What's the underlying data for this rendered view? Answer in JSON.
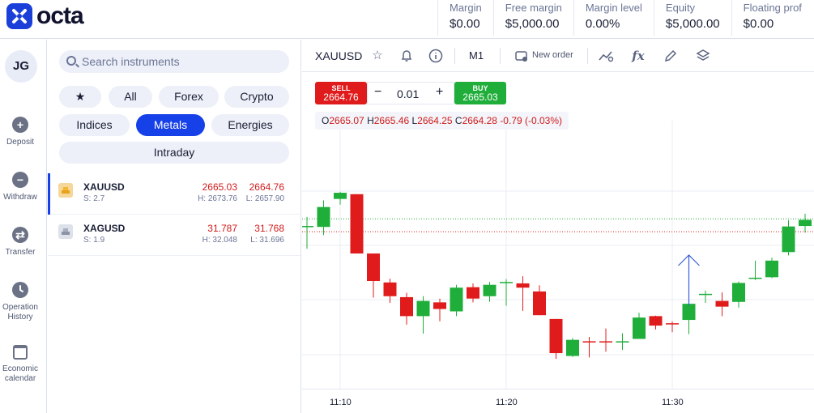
{
  "app": {
    "brand": "octa"
  },
  "account": {
    "stats": [
      {
        "label": "Margin",
        "value": "$0.00"
      },
      {
        "label": "Free margin",
        "value": "$5,000.00"
      },
      {
        "label": "Margin level",
        "value": "0.00%"
      },
      {
        "label": "Equity",
        "value": "$5,000.00"
      },
      {
        "label": "Floating prof",
        "value": "$0.00"
      }
    ]
  },
  "nav": {
    "avatar": "JG",
    "items": [
      {
        "label": "Deposit",
        "icon": "plus-circle-icon"
      },
      {
        "label": "Withdraw",
        "icon": "minus-circle-icon"
      },
      {
        "label": "Transfer",
        "icon": "transfer-icon"
      },
      {
        "label": "Operation History",
        "icon": "clock-icon"
      },
      {
        "label": "Economic calendar",
        "icon": "calendar-icon"
      }
    ]
  },
  "instruments": {
    "search_placeholder": "Search instruments",
    "filters": [
      "All",
      "Forex",
      "Crypto",
      "Indices",
      "Metals",
      "Energies",
      "Intraday"
    ],
    "active_filter": "Metals",
    "rows": [
      {
        "symbol": "XAUUSD",
        "spread": "S: 2.7",
        "bid": "2665.03",
        "ask": "2664.76",
        "high": "H: 2673.76",
        "low": "L: 2657.90"
      },
      {
        "symbol": "XAGUSD",
        "spread": "S: 1.9",
        "bid": "31.787",
        "ask": "31.768",
        "high": "H: 32.048",
        "low": "L: 31.696"
      }
    ]
  },
  "chart_toolbar": {
    "symbol": "XAUUSD",
    "timeframe": "M1",
    "new_order": "New order"
  },
  "trade": {
    "sell_label": "SELL",
    "sell_price": "2664.76",
    "buy_label": "BUY",
    "buy_price": "2665.03",
    "lot": "0.01",
    "minus": "−",
    "plus": "+"
  },
  "ohlc": {
    "o_label": "O",
    "o": "2665.07",
    "h_label": "H",
    "h": "2665.46",
    "l_label": "L",
    "l": "2664.25",
    "c_label": "C",
    "c": "2664.28",
    "change": "-0.79 (-0.03%)"
  },
  "chart_data": {
    "type": "candlestick",
    "x_ticks": [
      "11:10",
      "11:20",
      "11:30"
    ],
    "candles": [
      {
        "o": 2664.88,
        "h": 2665.07,
        "l": 2664.4,
        "c": 2664.88
      },
      {
        "o": 2664.86,
        "h": 2665.42,
        "l": 2664.69,
        "c": 2665.28
      },
      {
        "o": 2665.45,
        "h": 2665.6,
        "l": 2665.33,
        "c": 2665.58
      },
      {
        "o": 2665.55,
        "h": 2665.55,
        "l": 2664.3,
        "c": 2664.3
      },
      {
        "o": 2664.3,
        "h": 2664.3,
        "l": 2663.37,
        "c": 2663.72
      },
      {
        "o": 2663.69,
        "h": 2663.77,
        "l": 2663.26,
        "c": 2663.4
      },
      {
        "o": 2663.38,
        "h": 2663.47,
        "l": 2662.8,
        "c": 2662.98
      },
      {
        "o": 2662.98,
        "h": 2663.4,
        "l": 2662.61,
        "c": 2663.3
      },
      {
        "o": 2663.27,
        "h": 2663.35,
        "l": 2662.87,
        "c": 2663.13
      },
      {
        "o": 2663.08,
        "h": 2663.64,
        "l": 2662.98,
        "c": 2663.58
      },
      {
        "o": 2663.59,
        "h": 2663.67,
        "l": 2663.27,
        "c": 2663.35
      },
      {
        "o": 2663.4,
        "h": 2663.7,
        "l": 2663.28,
        "c": 2663.64
      },
      {
        "o": 2663.7,
        "h": 2663.76,
        "l": 2663.2,
        "c": 2663.7
      },
      {
        "o": 2663.67,
        "h": 2663.82,
        "l": 2663.09,
        "c": 2663.58
      },
      {
        "o": 2663.5,
        "h": 2663.63,
        "l": 2663.0,
        "c": 2663.0
      },
      {
        "o": 2662.92,
        "h": 2662.92,
        "l": 2662.08,
        "c": 2662.2
      },
      {
        "o": 2662.14,
        "h": 2662.52,
        "l": 2662.12,
        "c": 2662.48
      },
      {
        "o": 2662.45,
        "h": 2662.54,
        "l": 2662.11,
        "c": 2662.44
      },
      {
        "o": 2662.45,
        "h": 2662.72,
        "l": 2662.23,
        "c": 2662.44
      },
      {
        "o": 2662.45,
        "h": 2662.62,
        "l": 2662.27,
        "c": 2662.45
      },
      {
        "o": 2662.5,
        "h": 2663.05,
        "l": 2662.5,
        "c": 2662.95
      },
      {
        "o": 2662.98,
        "h": 2662.99,
        "l": 2662.7,
        "c": 2662.78
      },
      {
        "o": 2662.83,
        "h": 2662.87,
        "l": 2662.64,
        "c": 2662.81
      },
      {
        "o": 2662.9,
        "h": 2663.42,
        "l": 2662.6,
        "c": 2663.24
      },
      {
        "o": 2663.45,
        "h": 2663.52,
        "l": 2663.26,
        "c": 2663.45
      },
      {
        "o": 2663.3,
        "h": 2663.48,
        "l": 2662.98,
        "c": 2663.18
      },
      {
        "o": 2663.28,
        "h": 2663.71,
        "l": 2663.16,
        "c": 2663.68
      },
      {
        "o": 2663.78,
        "h": 2664.15,
        "l": 2663.74,
        "c": 2663.79
      },
      {
        "o": 2663.8,
        "h": 2664.21,
        "l": 2663.78,
        "c": 2664.15
      },
      {
        "o": 2664.33,
        "h": 2665.0,
        "l": 2664.26,
        "c": 2664.87
      },
      {
        "o": 2664.88,
        "h": 2665.14,
        "l": 2664.74,
        "c": 2665.01
      }
    ],
    "y_range": [
      2661.45,
      2667.1
    ],
    "colors": {
      "up": "#1fae3a",
      "down": "#e01b1b",
      "arrow": "#3a5fd8"
    }
  }
}
